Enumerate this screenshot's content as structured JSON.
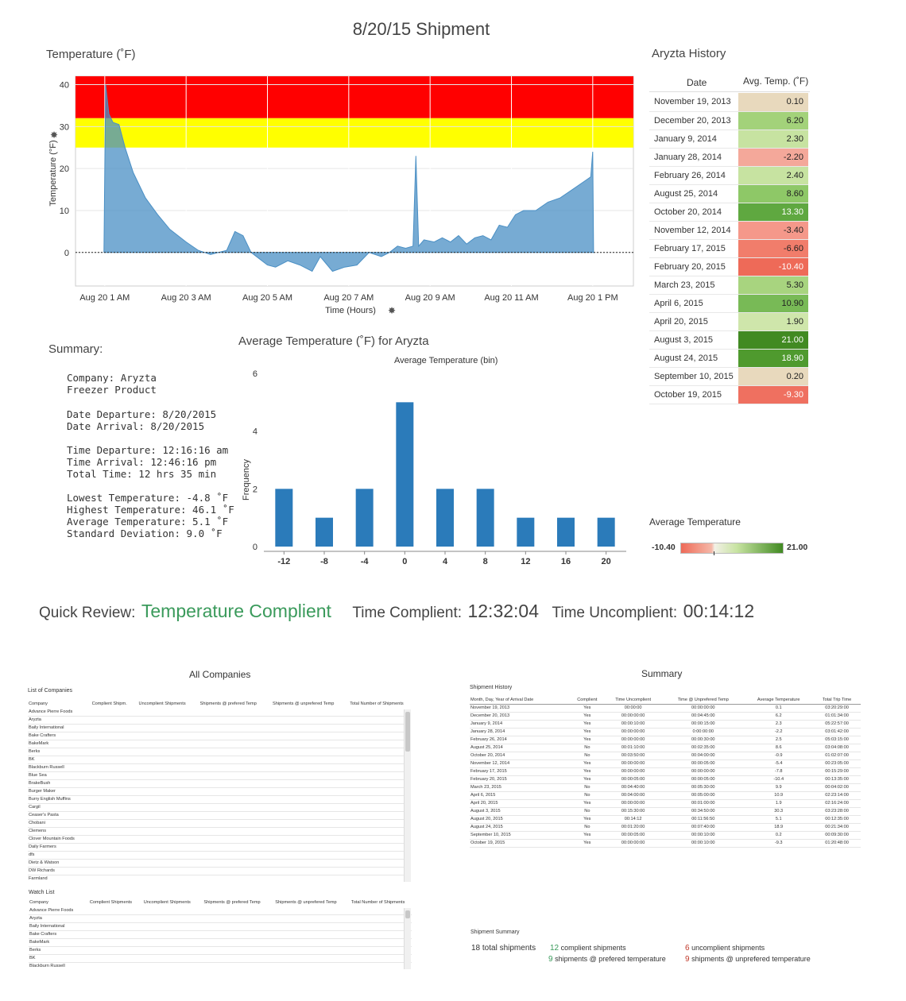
{
  "page_title": "8/20/15  Shipment",
  "temp_chart": {
    "title": "Temperature (˚F)",
    "ylabel": "Temperature (°F)",
    "xlabel": "Time (Hours)",
    "y_ticks": [
      "40",
      "30",
      "20",
      "10",
      "0"
    ],
    "x_ticks": [
      "Aug 20 1 AM",
      "Aug 20 3 AM",
      "Aug 20 5 AM",
      "Aug 20 7 AM",
      "Aug 20 9 AM",
      "Aug 20 11 AM",
      "Aug 20 1 PM"
    ],
    "bands": [
      {
        "from": 32,
        "to": 42,
        "color": "#ff0000"
      },
      {
        "from": 25,
        "to": 32,
        "color": "#ffff00"
      }
    ],
    "area_color": "#4a8fc4"
  },
  "chart_data": [
    {
      "type": "area",
      "title": "Temperature (˚F)",
      "xlabel": "Time (Hours)",
      "ylabel": "Temperature (°F)",
      "x_unit": "hours",
      "xlim": [
        0.28,
        14.0
      ],
      "ylim": [
        -8,
        42
      ],
      "x": [
        0.98,
        1.02,
        1.1,
        1.2,
        1.35,
        1.5,
        1.7,
        2.0,
        2.3,
        2.6,
        3.0,
        3.3,
        3.6,
        4.0,
        4.2,
        4.4,
        4.6,
        4.8,
        5.0,
        5.2,
        5.5,
        5.8,
        6.1,
        6.3,
        6.6,
        6.9,
        7.2,
        7.5,
        7.8,
        8.0,
        8.2,
        8.4,
        8.58,
        8.65,
        8.72,
        8.85,
        9.1,
        9.3,
        9.5,
        9.7,
        9.9,
        10.1,
        10.3,
        10.5,
        10.7,
        10.9,
        11.1,
        11.3,
        11.6,
        11.9,
        12.2,
        12.5,
        12.8,
        12.95,
        13.0,
        13.02
      ],
      "y": [
        0,
        40,
        33,
        31,
        30.5,
        25,
        19,
        13,
        9,
        5.5,
        2.5,
        0.5,
        -0.5,
        0.5,
        5,
        4,
        0,
        -1.5,
        -3,
        -3.5,
        -2,
        -3,
        -4.5,
        -1,
        -4.5,
        -3.5,
        -3,
        0,
        -1,
        0,
        1.5,
        1,
        1.5,
        23,
        1.5,
        3,
        2.5,
        3.5,
        2.5,
        4,
        2,
        3.5,
        4,
        3,
        6.5,
        6,
        9,
        10,
        10,
        12,
        13,
        15,
        17,
        18,
        24,
        0
      ]
    },
    {
      "type": "bar",
      "title": "Average Temperature (˚F) for Aryzta",
      "subtitle": "Average Temperature (bin)",
      "ylabel": "Frequency",
      "categories": [
        "-12",
        "-8",
        "-4",
        "0",
        "4",
        "8",
        "12",
        "16",
        "20"
      ],
      "values": [
        2,
        1,
        2,
        5,
        2,
        2,
        1,
        1,
        1
      ],
      "ylim": [
        0,
        6
      ],
      "y_ticks": [
        "6",
        "4",
        "2",
        "0"
      ],
      "color": "#2b7bba"
    }
  ],
  "history": {
    "title": "Aryzta History",
    "col_date": "Date",
    "col_temp": "Avg. Temp. (˚F)",
    "rows": [
      {
        "date": "November 19, 2013",
        "temp": "0.10",
        "color": "#e8d9bd",
        "light": false
      },
      {
        "date": "December 20, 2013",
        "temp": "6.20",
        "color": "#a3d27a",
        "light": false
      },
      {
        "date": "January 9, 2014",
        "temp": "2.30",
        "color": "#c7e3a1",
        "light": false
      },
      {
        "date": "January 28, 2014",
        "temp": "-2.20",
        "color": "#f4a89a",
        "light": false
      },
      {
        "date": "February 26, 2014",
        "temp": "2.40",
        "color": "#c7e3a1",
        "light": false
      },
      {
        "date": "August 25, 2014",
        "temp": "8.60",
        "color": "#8ec867",
        "light": false
      },
      {
        "date": "October 20, 2014",
        "temp": "13.30",
        "color": "#5fa840",
        "light": true
      },
      {
        "date": "November 12, 2014",
        "temp": "-3.40",
        "color": "#f5988a",
        "light": false
      },
      {
        "date": "February 17, 2015",
        "temp": "-6.60",
        "color": "#f17d6b",
        "light": false
      },
      {
        "date": "February 20, 2015",
        "temp": "-10.40",
        "color": "#ee6a58",
        "light": true
      },
      {
        "date": "March 23, 2015",
        "temp": "5.30",
        "color": "#a8d47f",
        "light": false
      },
      {
        "date": "April 6, 2015",
        "temp": "10.90",
        "color": "#78ba56",
        "light": false
      },
      {
        "date": "April 20, 2015",
        "temp": "1.90",
        "color": "#cfe6ab",
        "light": false
      },
      {
        "date": "August 3, 2015",
        "temp": "21.00",
        "color": "#418a22",
        "light": true
      },
      {
        "date": "August 24, 2015",
        "temp": "18.90",
        "color": "#4f9a2e",
        "light": true
      },
      {
        "date": "September 10, 2015",
        "temp": "0.20",
        "color": "#e8d9bd",
        "light": false
      },
      {
        "date": "October 19, 2015",
        "temp": "-9.30",
        "color": "#ef7060",
        "light": true
      }
    ]
  },
  "legend": {
    "title": "Average Temperature",
    "min": "-10.40",
    "max": "21.00"
  },
  "summary": {
    "title": "Summary:",
    "company": "Company: Aryzta",
    "product": "Freezer Product",
    "date_departure": "Date Departure: 8/20/2015",
    "date_arrival": "Date Arrival: 8/20/2015",
    "time_departure": "Time Departure: 12:16:16 am",
    "time_arrival": "Time Arrival: 12:46:16 pm",
    "total_time": "Total Time: 12 hrs 35 min",
    "lowest": "Lowest Temperature: -4.8 ˚F",
    "highest": "Highest Temperature: 46.1 ˚F",
    "average": "Average Temperature: 5.1 ˚F",
    "stddev": "Standard Deviation: 9.0 ˚F"
  },
  "quick_review": {
    "label": "Quick Review:",
    "status": "Temperature Complient",
    "status_color": "#3a9a5b",
    "compliant_label": "Time Complient:",
    "compliant_value": "12:32:04",
    "uncompliant_label": "Time Uncomplient:",
    "uncompliant_value": "00:14:12"
  },
  "all_companies": {
    "title": "All Companies",
    "list_title": "List of Companies",
    "columns": [
      "Company",
      "Complient Shipm.",
      "Uncomplient Shipments",
      "Shipments @ prefered Temp",
      "Shipments @ unprefered Temp",
      "Total Number of Shipments"
    ],
    "rows": [
      "Advance Pierre Foods",
      "Aryzta",
      "Baily International",
      "Bake Crafters",
      "BakeMark",
      "Berks",
      "BK",
      "Blackburn Russell",
      "Blue Sea",
      "BrakeBush",
      "Burger Maker",
      "Burry English Muffins",
      "Cargil",
      "Ceaser's Pasta",
      "Chobani",
      "Clemens",
      "Clover Mountain Foods",
      "Daily Farmers",
      "dfs",
      "Dietz & Watson",
      "DW Richards",
      "Farmland"
    ],
    "watch_title": "Watch List",
    "watch_columns": [
      "Company",
      "Complient Shipments",
      "Uncomplient Shipments",
      "Shipments @ prefered Temp",
      "Shipments @ unprefered Temp",
      "Total Number of Shipments"
    ],
    "watch_rows": [
      "Advance Pierre Foods",
      "Aryzta",
      "Baily International",
      "Bake Crafters",
      "BakeMark",
      "Berks",
      "BK",
      "Blackburn Russell"
    ]
  },
  "summary_panel": {
    "title": "Summary",
    "history_title": "Shipment History",
    "columns": [
      "Month, Day, Year of Arrival Date",
      "Complient",
      "Time Uncomplient",
      "Time @ Unprefered Temp",
      "Average Temperature",
      "Total Trip Time"
    ],
    "rows": [
      [
        "November 19, 2013",
        "Yes",
        "00:00:00",
        "00:00:00:00",
        "0.1",
        "03:20:29:00"
      ],
      [
        "December 20, 2013",
        "Yes",
        "00:00:00:00",
        "00:04:45:00",
        "6.2",
        "01:01:34:00"
      ],
      [
        "January 9, 2014",
        "Yes",
        "00:00:10:00",
        "00:00:15:00",
        "2.3",
        "05:22:57:00"
      ],
      [
        "January 28, 2014",
        "Yes",
        "00:00:00:00",
        "0:00:00:00",
        "-2.2",
        "03:01:42:00"
      ],
      [
        "February 26, 2014",
        "Yes",
        "00:00:00:00",
        "00:00:30:00",
        "2.5",
        "05:03:15:00"
      ],
      [
        "August 25, 2014",
        "No",
        "00:01:10:00",
        "00:02:35:00",
        "8.6",
        "03:04:08:00"
      ],
      [
        "October 20, 2014",
        "No",
        "00:03:50:00",
        "00:04:00:00",
        "-0.9",
        "01:02:07:00"
      ],
      [
        "November 12, 2014",
        "Yes",
        "00:00:00:00",
        "00:00:05:00",
        "-5.4",
        "00:23:05:00"
      ],
      [
        "February 17, 2015",
        "Yes",
        "00:00:00:00",
        "00:00:00:00",
        "-7.8",
        "00:15:29:00"
      ],
      [
        "February 20, 2015",
        "Yes",
        "00:00:05:00",
        "00:00:05:00",
        "-10.4",
        "00:13:35:00"
      ],
      [
        "March 23, 2015",
        "No",
        "00:04:40:00",
        "00:05:30:00",
        "9.9",
        "00:04:02:00"
      ],
      [
        "April 6, 2015",
        "No",
        "00:04:00:00",
        "00:05:00:00",
        "10.9",
        "02:23:14:00"
      ],
      [
        "April 20, 2015",
        "Yes",
        "00:00:00:00",
        "00:01:00:00",
        "1.9",
        "02:16:24:00"
      ],
      [
        "August 3, 2015",
        "No",
        "00:15:30:00",
        "00:34:50:00",
        "30.3",
        "03:23:28:00"
      ],
      [
        "August 20, 2015",
        "Yes",
        "00:14:12",
        "00:11:56:50",
        "5.1",
        "00:12:35:00"
      ],
      [
        "August 24, 2015",
        "No",
        "00:01:20:00",
        "00:07:40:00",
        "18.9",
        "00:21:34:00"
      ],
      [
        "September 10, 2015",
        "Yes",
        "00:00:05:00",
        "00:00:10:00",
        "0.2",
        "00:09:30:00"
      ],
      [
        "October 19, 2015",
        "Yes",
        "00:00:00:00",
        "00:00:10:00",
        "-9.3",
        "01:20:48:00"
      ]
    ],
    "ss_title": "Shipment Summary",
    "total": "18 total shipments",
    "compliant_n": "12",
    "compliant_txt": "complient shipments",
    "uncompliant_n": "6",
    "uncompliant_txt": "uncomplient shipments",
    "pref_n": "9",
    "pref_txt": "shipments @ prefered temperature",
    "unpref_n": "9",
    "unpref_txt": "shipments @ unprefered temperature"
  }
}
